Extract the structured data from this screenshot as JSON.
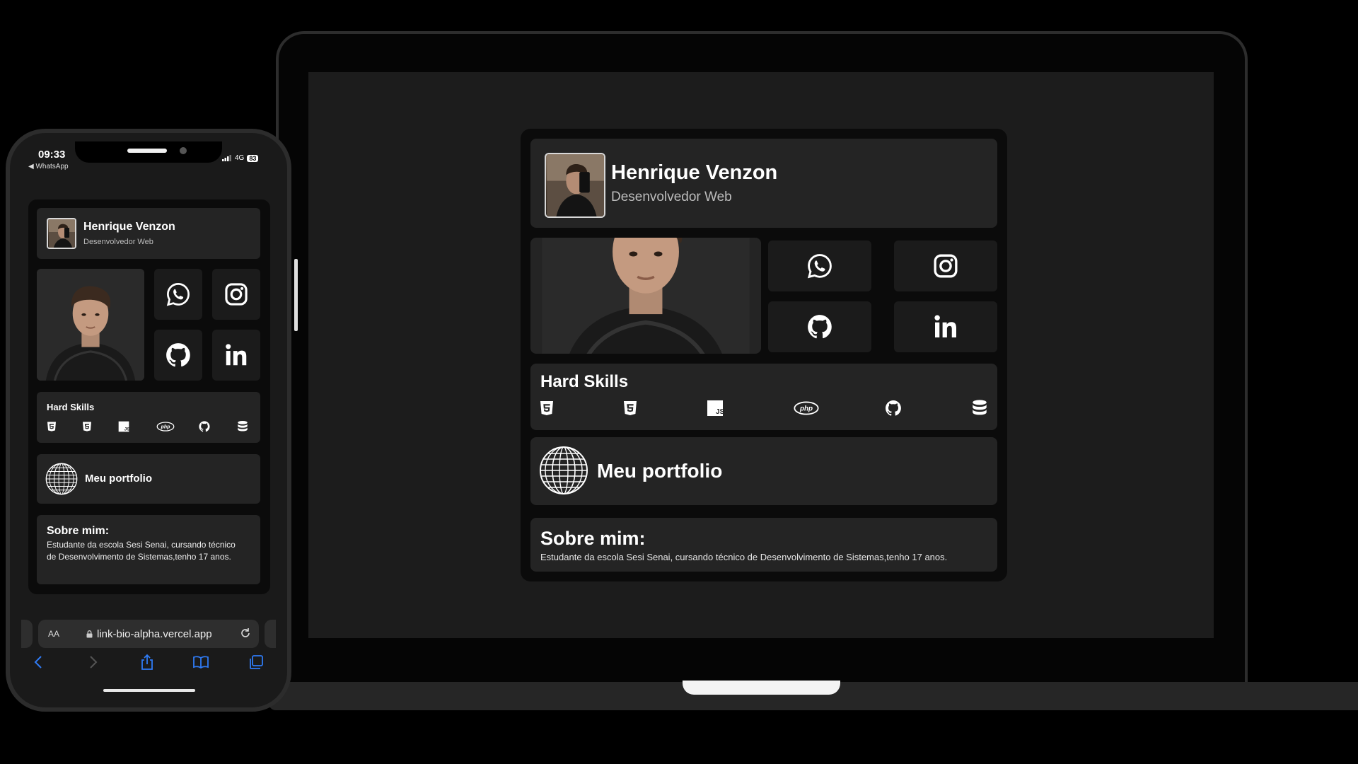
{
  "profile": {
    "name": "Henrique Venzon",
    "role": "Desenvolvedor Web"
  },
  "social": [
    "whatsapp-icon",
    "instagram-icon",
    "github-icon",
    "linkedin-icon"
  ],
  "skills": {
    "title": "Hard Skills",
    "icons": [
      "html5-icon",
      "css3-icon",
      "javascript-icon",
      "php-icon",
      "github-icon",
      "database-icon"
    ]
  },
  "portfolio": {
    "label": "Meu portfolio"
  },
  "about": {
    "title": "Sobre mim:",
    "text": "Estudante da escola Sesi Senai, cursando técnico de Desenvolvimento de Sistemas,tenho 17 anos."
  },
  "phone": {
    "time": "09:33",
    "back_app": "◀ WhatsApp",
    "network": "4G",
    "battery": "83",
    "url_aa": "AA",
    "url": "link-bio-alpha.vercel.app"
  },
  "colors": {
    "background": "#000000",
    "screen": "#1c1c1c",
    "card": "#0b0b0b",
    "panel": "#242424",
    "tile": "#1b1b1b",
    "accent_ios": "#2f7bf5"
  }
}
